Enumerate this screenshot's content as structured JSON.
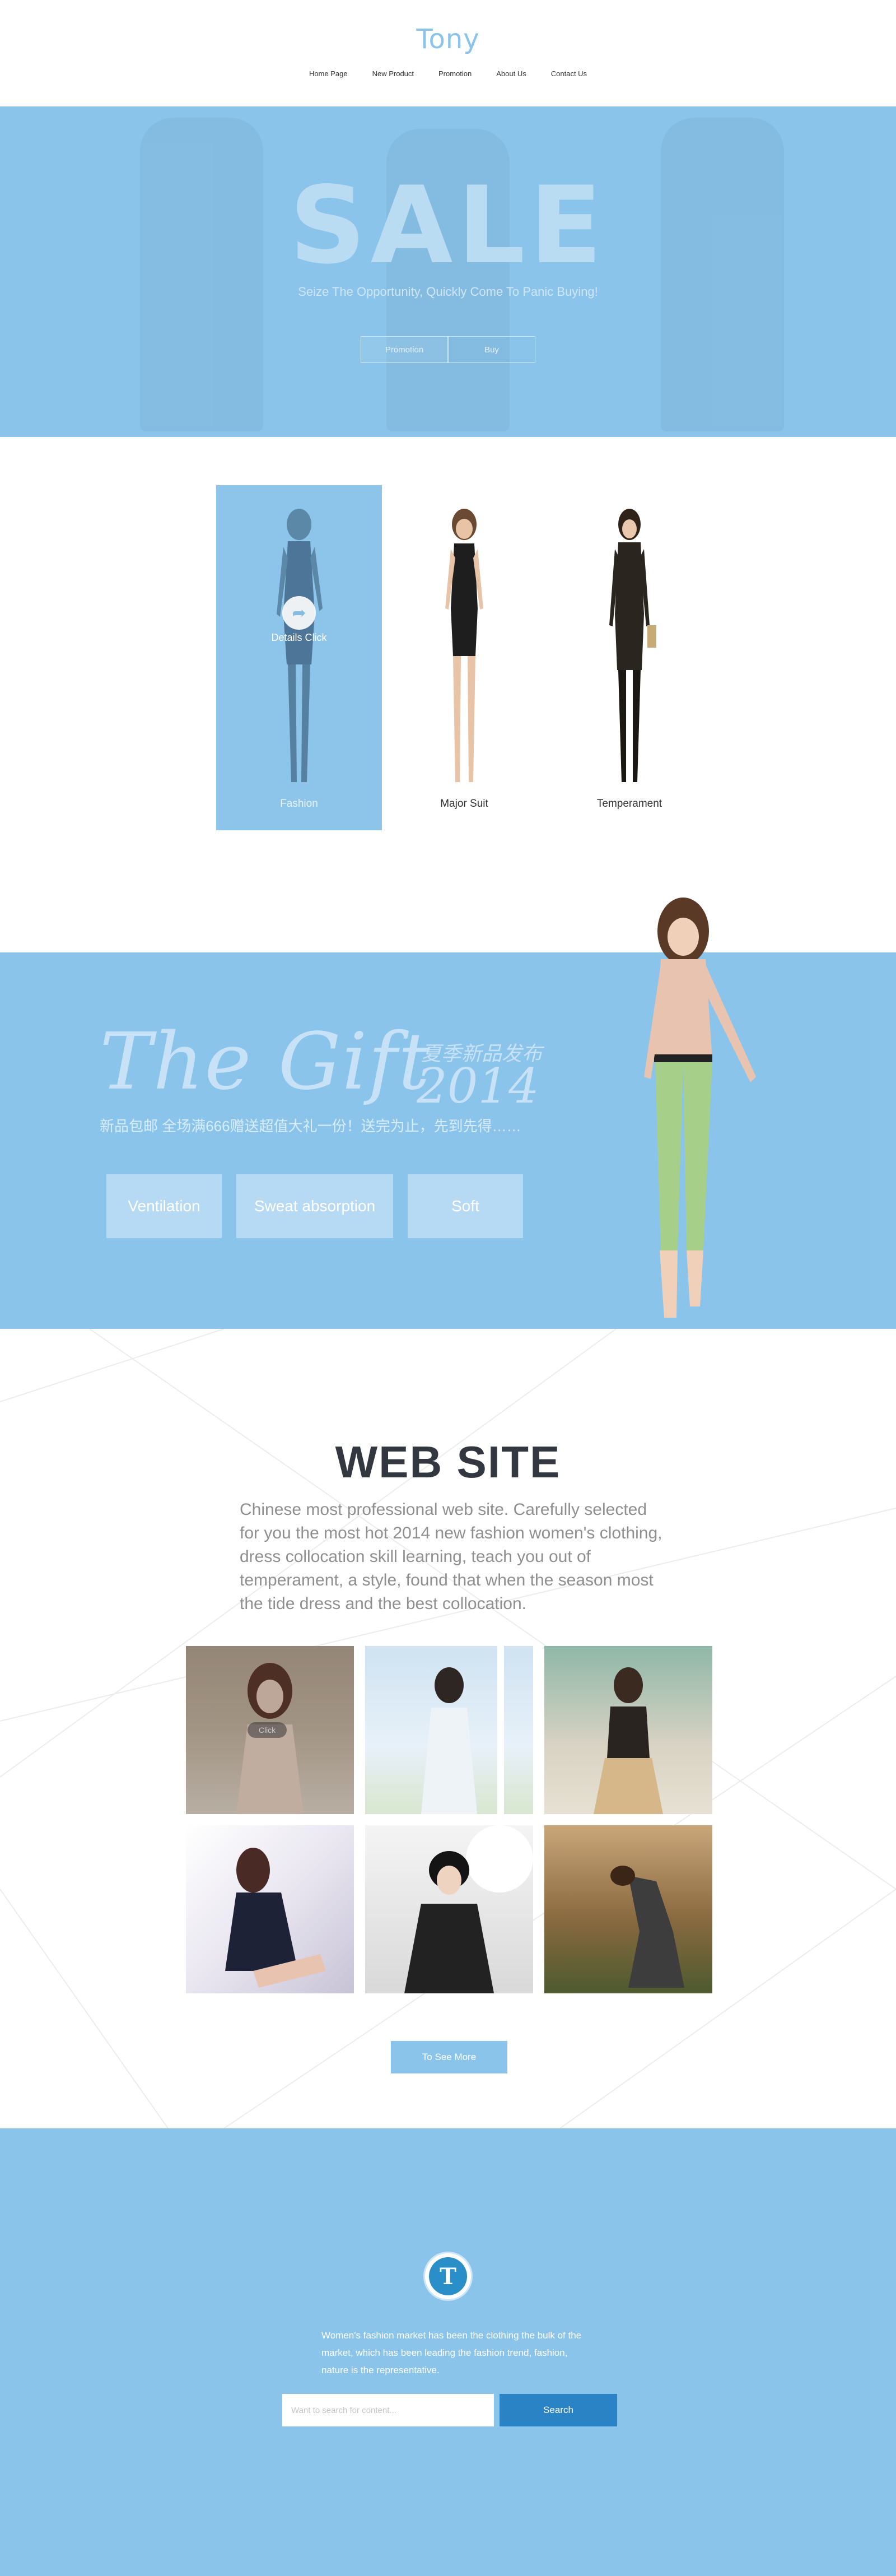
{
  "header": {
    "logo": "Tony",
    "nav": [
      "Home Page",
      "New Product",
      "Promotion",
      "About Us",
      "Contact Us"
    ]
  },
  "sale": {
    "title": "SALE",
    "subtitle": "Seize The Opportunity, Quickly Come To Panic Buying!",
    "buttons": [
      "Promotion",
      "Buy"
    ]
  },
  "products": {
    "items": [
      {
        "label": "Fashion",
        "overlay": "Details Click",
        "active": true
      },
      {
        "label": "Major Suit",
        "active": false
      },
      {
        "label": "Temperament",
        "active": false
      }
    ]
  },
  "gift": {
    "title": "The Gift",
    "cn_top": "夏季新品发布",
    "year": "2014",
    "tagline": "新品包邮 全场满666赠送超值大礼一份！送完为止，先到先得……",
    "tags": [
      "Ventilation",
      "Sweat absorption",
      "Soft"
    ]
  },
  "website": {
    "title": "WEB SITE",
    "description": "Chinese most professional web site. Carefully selected for you the most hot 2014 new fashion women's clothing, dress collocation skill learning, teach you out of temperament, a style, found that when the season most the tide dress and the best collocation.",
    "click_label": "Click",
    "see_more": "To See More"
  },
  "footer": {
    "text": "Women's fashion market has been the clothing the bulk of the market, which has been leading the fashion trend, fashion, nature is the representative.",
    "search_placeholder": "Want to search for content...",
    "search_button": "Search"
  },
  "colors": {
    "accent": "#8bc4ea",
    "accent_dark": "#2a83c4",
    "title_dark": "#333840"
  }
}
